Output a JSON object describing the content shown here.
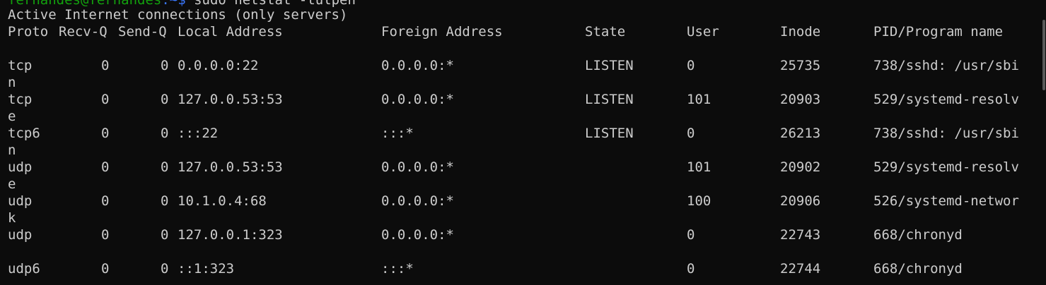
{
  "terminal": {
    "prompt_user": "fernandes@fernandes",
    "prompt_path": ":~$",
    "prompt_command": " sudo netstat -tulpen",
    "heading": "Active Internet connections (only servers)",
    "columns": {
      "proto": "Proto",
      "recvq": "Recv-Q",
      "sendq": "Send-Q",
      "local": "Local Address",
      "foreign": "Foreign Address",
      "state": "State",
      "user": "User",
      "inode": "Inode",
      "pid": "PID/Program name"
    },
    "rows": [
      {
        "proto": "tcp",
        "recvq": "0",
        "sendq": "0",
        "local": "0.0.0.0:22",
        "foreign": "0.0.0.0:*",
        "state": "LISTEN",
        "user": "0",
        "inode": "25735",
        "pid": "738/sshd: /usr/sbi",
        "wrap": "n"
      },
      {
        "proto": "tcp",
        "recvq": "0",
        "sendq": "0",
        "local": "127.0.0.53:53",
        "foreign": "0.0.0.0:*",
        "state": "LISTEN",
        "user": "101",
        "inode": "20903",
        "pid": "529/systemd-resolv",
        "wrap": "e"
      },
      {
        "proto": "tcp6",
        "recvq": "0",
        "sendq": "0",
        "local": ":::22",
        "foreign": ":::*",
        "state": "LISTEN",
        "user": "0",
        "inode": "26213",
        "pid": "738/sshd: /usr/sbi",
        "wrap": "n"
      },
      {
        "proto": "udp",
        "recvq": "0",
        "sendq": "0",
        "local": "127.0.0.53:53",
        "foreign": "0.0.0.0:*",
        "state": "",
        "user": "101",
        "inode": "20902",
        "pid": "529/systemd-resolv",
        "wrap": "e"
      },
      {
        "proto": "udp",
        "recvq": "0",
        "sendq": "0",
        "local": "10.1.0.4:68",
        "foreign": "0.0.0.0:*",
        "state": "",
        "user": "100",
        "inode": "20906",
        "pid": "526/systemd-networ",
        "wrap": "k"
      },
      {
        "proto": "udp",
        "recvq": "0",
        "sendq": "0",
        "local": "127.0.0.1:323",
        "foreign": "0.0.0.0:*",
        "state": "",
        "user": "0",
        "inode": "22743",
        "pid": "668/chronyd",
        "wrap": ""
      },
      {
        "proto": "udp6",
        "recvq": "0",
        "sendq": "0",
        "local": "::1:323",
        "foreign": ":::*",
        "state": "",
        "user": "0",
        "inode": "22744",
        "pid": "668/chronyd",
        "wrap": ""
      }
    ]
  },
  "colors": {
    "background": "#0c0c0c",
    "text": "#cccccc",
    "prompt_user": "#13a10e",
    "prompt_path": "#3b78ff"
  }
}
